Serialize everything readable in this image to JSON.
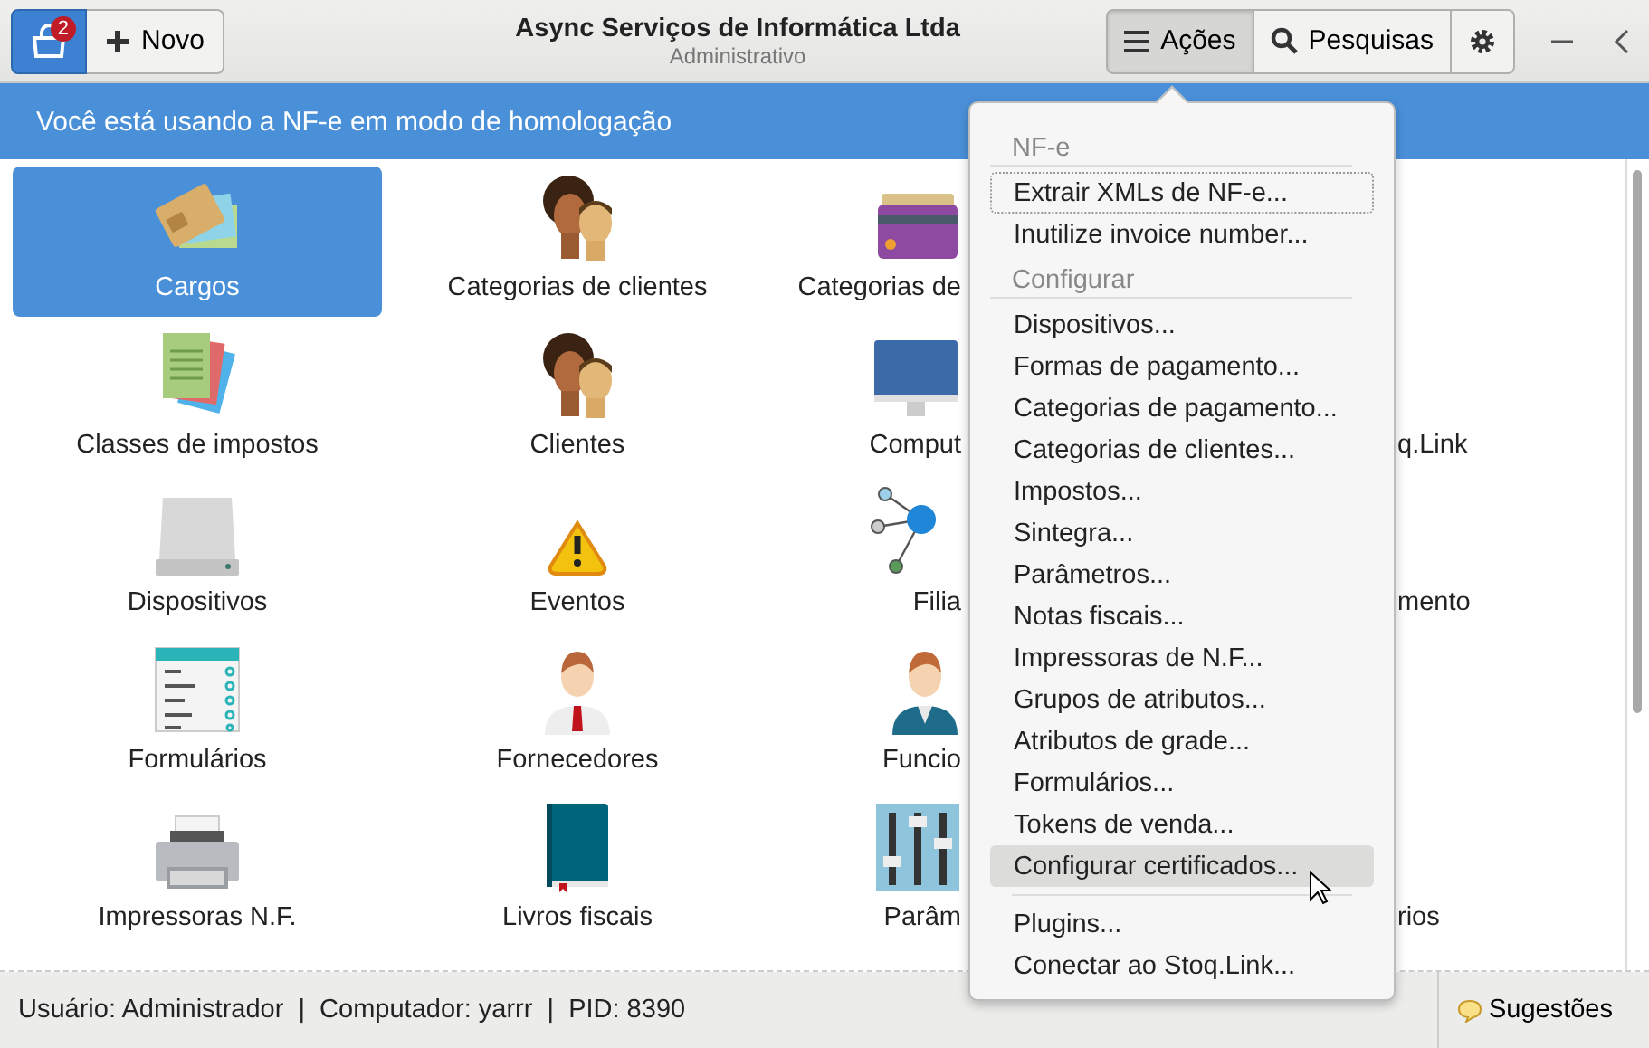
{
  "header": {
    "notifications_badge": "2",
    "new_button": "Novo",
    "title": "Async Serviços de Informática Ltda",
    "subtitle": "Administrativo",
    "toolbar": [
      {
        "kind": "menu",
        "label": "Ações",
        "active": true
      },
      {
        "kind": "search",
        "label": "Pesquisas",
        "active": false
      },
      {
        "kind": "settings",
        "active": false
      }
    ]
  },
  "banner": "Você está usando a NF-e em modo de homologação",
  "launcher": {
    "rows": [
      {
        "cells": [
          {
            "label": "Cargos",
            "selected": true
          },
          {
            "label": "Categorias de clientes",
            "selected": false
          },
          {
            "label": "Categorias de",
            "selected": false
          }
        ]
      },
      {
        "cells": [
          {
            "label": "Classes de impostos",
            "selected": false
          },
          {
            "label": "Clientes",
            "selected": false
          },
          {
            "label": "Comput",
            "selected": false
          },
          {
            "label": "q.Link",
            "selected": false
          }
        ]
      },
      {
        "cells": [
          {
            "label": "Dispositivos",
            "selected": false
          },
          {
            "label": "Eventos",
            "selected": false
          },
          {
            "label": "Filia",
            "selected": false
          },
          {
            "label": "mento",
            "selected": false
          }
        ]
      },
      {
        "cells": [
          {
            "label": "Formulários",
            "selected": false
          },
          {
            "label": "Fornecedores",
            "selected": false
          },
          {
            "label": "Funcio",
            "selected": false
          }
        ]
      },
      {
        "cells": [
          {
            "label": "Impressoras N.F.",
            "selected": false
          },
          {
            "label": "Livros fiscais",
            "selected": false
          },
          {
            "label": "Parâm",
            "selected": false
          },
          {
            "label": "rios",
            "selected": false
          }
        ]
      }
    ]
  },
  "menu": {
    "sections": [
      {
        "title": "NF-e",
        "items": [
          {
            "label": "Extrair XMLs de NF-e...",
            "selected": false,
            "focused": true
          },
          {
            "label": "Inutilize invoice number...",
            "selected": false,
            "focused": false
          }
        ]
      },
      {
        "title": "Configurar",
        "items": [
          {
            "label": "Dispositivos...",
            "selected": false,
            "focused": false
          },
          {
            "label": "Formas de pagamento...",
            "selected": false,
            "focused": false
          },
          {
            "label": "Categorias de pagamento...",
            "selected": false,
            "focused": false
          },
          {
            "label": "Categorias de clientes...",
            "selected": false,
            "focused": false
          },
          {
            "label": "Impostos...",
            "selected": false,
            "focused": false
          },
          {
            "label": "Sintegra...",
            "selected": false,
            "focused": false
          },
          {
            "label": "Parâmetros...",
            "selected": false,
            "focused": false
          },
          {
            "label": "Notas fiscais...",
            "selected": false,
            "focused": false
          },
          {
            "label": "Impressoras de N.F...",
            "selected": false,
            "focused": false
          },
          {
            "label": "Grupos de atributos...",
            "selected": false,
            "focused": false
          },
          {
            "label": "Atributos de grade...",
            "selected": false,
            "focused": false
          },
          {
            "label": "Formulários...",
            "selected": false,
            "focused": false
          },
          {
            "label": "Tokens de venda...",
            "selected": false,
            "focused": false
          },
          {
            "label": "Configurar certificados...",
            "selected": true,
            "focused": false
          }
        ]
      },
      {
        "items": [
          {
            "label": "Plugins...",
            "selected": false,
            "focused": false
          },
          {
            "label": "Conectar ao Stoq.Link...",
            "selected": false,
            "focused": false
          }
        ]
      }
    ]
  },
  "status_bar": {
    "text": "Usuário: Administrador  |  Computador: yarrr  |  PID: 8390",
    "suggestions_button": "Sugestões"
  }
}
